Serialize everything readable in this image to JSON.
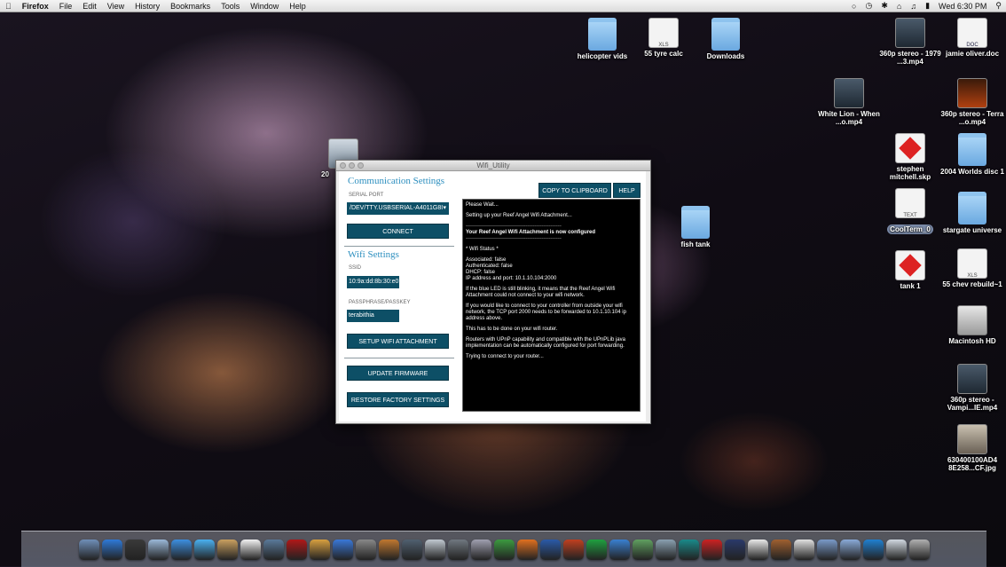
{
  "menubar": {
    "app_name": "Firefox",
    "items": [
      "File",
      "Edit",
      "View",
      "History",
      "Bookmarks",
      "Tools",
      "Window",
      "Help"
    ],
    "clock": "Wed 6:30 PM"
  },
  "desktop_icons": [
    {
      "label": "helicopter vids"
    },
    {
      "label": "55 tyre calc",
      "badge": "XLS"
    },
    {
      "label": "Downloads"
    },
    {
      "label": "360p stereo - 1979 ...3.mp4"
    },
    {
      "label": "jamie oliver.doc",
      "badge": "DOC"
    },
    {
      "label": "White Lion - When ...o.mp4"
    },
    {
      "label": "360p stereo - Terra ...o.mp4"
    },
    {
      "label": "stephen mitchell.skp"
    },
    {
      "label": "2004 Worlds disc 1"
    },
    {
      "label": "CoolTerm_0",
      "badge": "TEXT"
    },
    {
      "label": "stargate universe"
    },
    {
      "label": "fish tank"
    },
    {
      "label": "tank 1"
    },
    {
      "label": "55 chev rebuild~1",
      "badge": "XLS"
    },
    {
      "label": "Macintosh HD"
    },
    {
      "label": "360p stereo - Vampi...IE.mp4"
    },
    {
      "label": "630400100AD4 8E258...CF.jpg"
    },
    {
      "label": "20"
    }
  ],
  "window": {
    "title": "Wifi_Utility",
    "comm_heading": "Communication Settings",
    "serial_label": "SERIAL PORT",
    "serial_value": "/DEV/TTY.USBSERIAL-A4011G8I",
    "connect_label": "CONNECT",
    "wifi_heading": "Wifi Settings",
    "ssid_label": "SSID",
    "ssid_value": "10:9a:dd:8b:30:e0",
    "pass_label": "PASSPHRASE/PASSKEY",
    "pass_value": "terabithia",
    "setup_label": "SETUP WIFI ATTACHMENT",
    "update_label": "UPDATE FIRMWARE",
    "restore_label": "RESTORE FACTORY SETTINGS",
    "copy_label": "COPY TO CLIPBOARD",
    "help_label": "HELP",
    "console": {
      "l1": "Please Wait...",
      "l2": "Setting up your Reef Angel Wifi Attachment...",
      "rule": "------------------------------------------------------",
      "l3": "Your Reef Angel Wifi Attachment is now configured",
      "l4": "* Wifi Status *",
      "l5": "Associated: false",
      "l6": "Authenticated: false",
      "l7": "DHCP: false",
      "l8": "IP address and port: 10.1.10.104:2000",
      "l9": "If the blue LED is still blinking, it means that the Reef Angel Wifi Attachment could not connect to your wifi network.",
      "l10": "If you would like to connect to your controller from outside your wifi network, the TCP port 2000 needs to be forwarded to 10.1.10.104 ip address above.",
      "l11": "This has to be done on your wifi router.",
      "l12": "Routers with UPnP capability and compatible with the UPnPLib java implementation can be automatically configured for port forwarding.",
      "l13": "Trying to connect to your router..."
    }
  },
  "dock": {
    "items": [
      "finder-icon",
      "appstore-icon",
      "dashboard-icon",
      "mail-stamp-icon",
      "safari-icon",
      "ichat-icon",
      "addressbook-icon",
      "ical-icon",
      "iphoto-icon",
      "photobooth-icon",
      "image-icon",
      "itunes-icon",
      "imovie-icon",
      "garageband-icon",
      "timemachine-icon",
      "preview-icon",
      "system-prefs-icon",
      "script-icon",
      "numbers-icon",
      "firefox-icon",
      "word-icon",
      "powerpoint-icon",
      "excel-icon",
      "messenger-icon",
      "utility-icon",
      "transmission-icon",
      "arduino-icon",
      "sketchup-icon",
      "reefangel-icon",
      "textedit-icon",
      "tools-icon",
      "document-icon",
      "folder-icon",
      "folder2-icon",
      "downloads-icon",
      "stack-icon",
      "trash-icon"
    ]
  }
}
